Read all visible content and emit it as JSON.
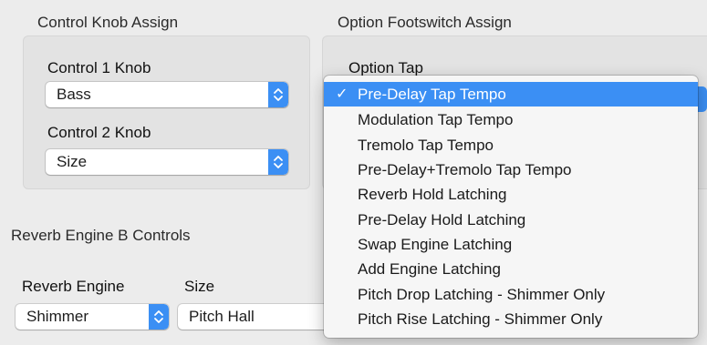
{
  "control_knob": {
    "title": "Control Knob Assign",
    "knob1_label": "Control 1 Knob",
    "knob1_value": "Bass",
    "knob2_label": "Control 2 Knob",
    "knob2_value": "Size"
  },
  "option_footswitch": {
    "title": "Option Footswitch Assign",
    "tap_label": "Option Tap",
    "menu": {
      "selected_index": 0,
      "items": [
        "Pre-Delay Tap Tempo",
        "Modulation Tap Tempo",
        "Tremolo Tap Tempo",
        "Pre-Delay+Tremolo Tap Tempo",
        "Reverb Hold Latching",
        "Pre-Delay Hold Latching",
        "Swap Engine Latching",
        "Add Engine Latching",
        "Pitch Drop Latching - Shimmer Only",
        "Pitch Rise Latching - Shimmer Only"
      ]
    }
  },
  "reverb_b": {
    "title": "Reverb Engine B Controls",
    "engine_label": "Reverb Engine",
    "engine_value": "Shimmer",
    "size_label": "Size",
    "size_value": "Pitch Hall"
  },
  "colors": {
    "accent": "#3b8ff4",
    "window_bg": "#ececec",
    "panel_bg": "#e3e3e3"
  },
  "icons": {
    "popup_stepper": "up-down-chevron-icon",
    "selected_mark": "checkmark-icon"
  }
}
